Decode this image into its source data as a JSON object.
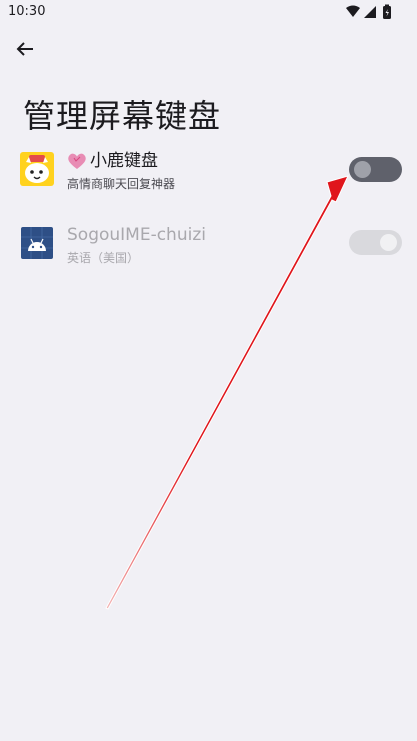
{
  "status_bar": {
    "time": "10:30"
  },
  "header": {
    "title": "管理屏幕键盘"
  },
  "keyboards": [
    {
      "name": "小鹿键盘",
      "subtitle": "高情商聊天回复神器",
      "enabled": false
    },
    {
      "name": "SogouIME-chuizi",
      "subtitle": "英语（美国）",
      "enabled": true,
      "disabled": true
    }
  ],
  "colors": {
    "arrow": "#e0161c",
    "background": "#f1f0f5",
    "switch_off_track": "#5f616b"
  },
  "icons": [
    "wifi-icon",
    "signal-icon",
    "battery-icon",
    "back-arrow-icon",
    "deer-keyboard-icon",
    "heart-icon",
    "android-icon"
  ]
}
